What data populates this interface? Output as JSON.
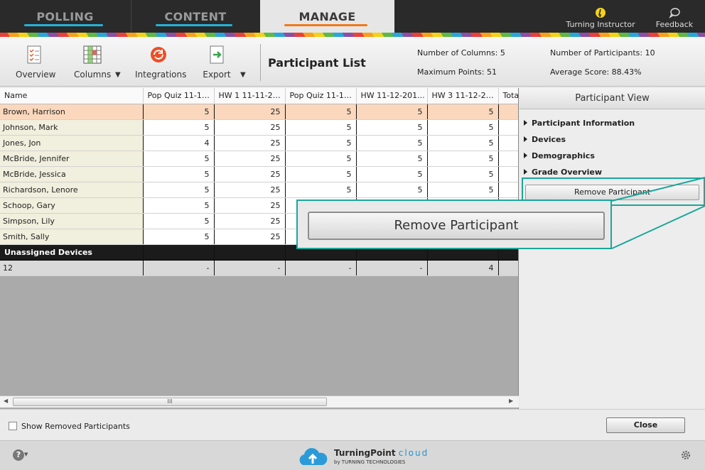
{
  "nav": {
    "tabs": [
      {
        "label": "POLLING"
      },
      {
        "label": "CONTENT"
      },
      {
        "label": "MANAGE"
      }
    ],
    "turning_instructor": "Turning Instructor",
    "feedback": "Feedback"
  },
  "toolbar": {
    "overview": "Overview",
    "columns": "Columns",
    "integrations": "Integrations",
    "export": "Export",
    "title": "Participant List",
    "num_columns": "Number of Columns: 5",
    "max_points": "Maximum Points: 51",
    "num_participants": "Number of Participants: 10",
    "avg_score": "Average Score: 88.43%"
  },
  "grid": {
    "headers": [
      "Name",
      "Pop Quiz 11-11...",
      "HW 1 11-11-20...",
      "Pop Quiz 11-12...",
      "HW 11-12-201...",
      "HW 3 11-12-20...",
      "Tota"
    ],
    "rows": [
      {
        "name": "Brown, Harrison",
        "cells": [
          "5",
          "25",
          "5",
          "5",
          "5",
          ""
        ]
      },
      {
        "name": "Johnson, Mark",
        "cells": [
          "5",
          "25",
          "5",
          "5",
          "5",
          ""
        ]
      },
      {
        "name": "Jones, Jon",
        "cells": [
          "4",
          "25",
          "5",
          "5",
          "5",
          ""
        ]
      },
      {
        "name": "McBride, Jennifer",
        "cells": [
          "5",
          "25",
          "5",
          "5",
          "5",
          ""
        ]
      },
      {
        "name": "McBride, Jessica",
        "cells": [
          "5",
          "25",
          "5",
          "5",
          "5",
          ""
        ]
      },
      {
        "name": "Richardson, Lenore",
        "cells": [
          "5",
          "25",
          "5",
          "5",
          "5",
          ""
        ]
      },
      {
        "name": "Schoop, Gary",
        "cells": [
          "5",
          "25",
          "",
          "",
          "",
          ""
        ]
      },
      {
        "name": "Simpson, Lily",
        "cells": [
          "5",
          "25",
          "",
          "",
          "",
          ""
        ]
      },
      {
        "name": "Smith, Sally",
        "cells": [
          "5",
          "25",
          "",
          "",
          "",
          ""
        ]
      }
    ],
    "unassigned_label": "Unassigned Devices",
    "device_row": {
      "name": "12",
      "cells": [
        "-",
        "-",
        "-",
        "-",
        "4",
        ""
      ]
    },
    "scroll_grip": "III"
  },
  "panel": {
    "title": "Participant View",
    "sections": [
      "Participant Information",
      "Devices",
      "Demographics",
      "Grade Overview"
    ],
    "remove_button": "Remove Participant"
  },
  "callout": {
    "button": "Remove Participant"
  },
  "bottom": {
    "show_removed": "Show Removed Participants",
    "close": "Close"
  },
  "footer": {
    "help": "?",
    "brand_name": "TurningPoint",
    "brand_cloud": "cloud",
    "brand_by": "by  TURNING TECHNOLOGIES"
  },
  "colors": {
    "accent_teal": "#1aa79a",
    "selected_row": "#fbd8bd",
    "name_column": "#f1efdd",
    "manage_underline": "#f07a1a",
    "tab_underline": "#22b3d9"
  }
}
